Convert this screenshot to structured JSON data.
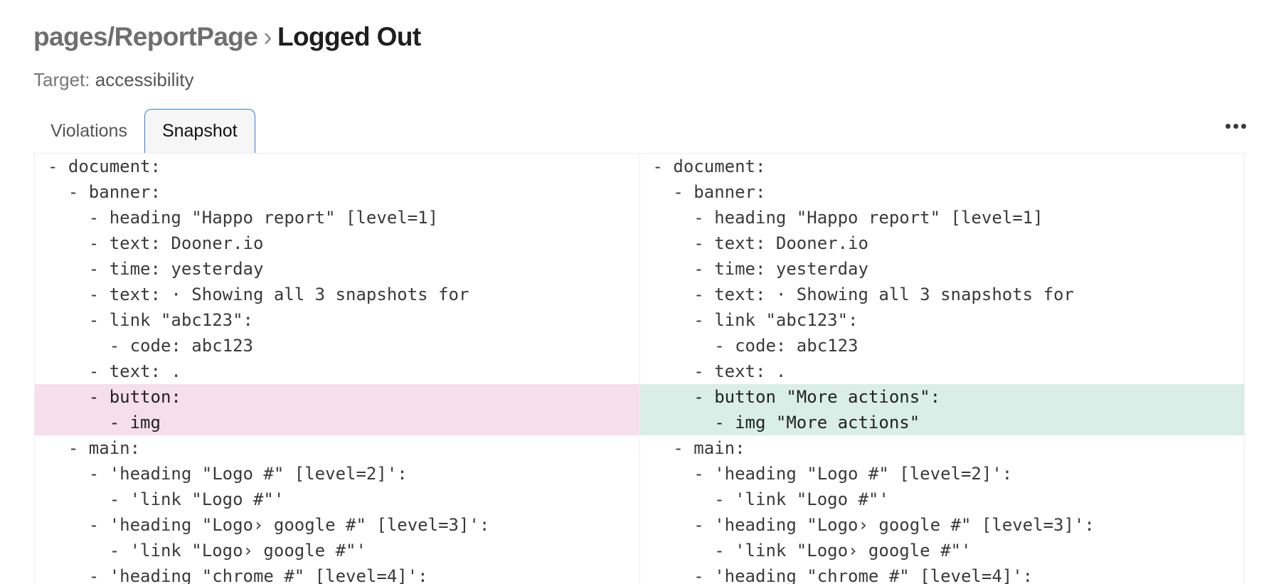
{
  "header": {
    "breadcrumb": "pages/ReportPage",
    "separator": "›",
    "title": "Logged Out",
    "target_label": "Target:",
    "target_value": "accessibility"
  },
  "tabs": [
    {
      "label": "Violations",
      "active": false
    },
    {
      "label": "Snapshot",
      "active": true
    }
  ],
  "menu_icon": "more-horizontal-icon",
  "colors": {
    "removed_bg": "#f6deec",
    "added_bg": "#d9eee7",
    "active_tab_border": "#2b7fe3"
  },
  "diff": {
    "left": [
      {
        "text": "- document:",
        "type": "same"
      },
      {
        "text": "  - banner:",
        "type": "same"
      },
      {
        "text": "    - heading \"Happo report\" [level=1]",
        "type": "same"
      },
      {
        "text": "    - text: Dooner.io",
        "type": "same"
      },
      {
        "text": "    - time: yesterday",
        "type": "same"
      },
      {
        "text": "    - text: · Showing all 3 snapshots for",
        "type": "same"
      },
      {
        "text": "    - link \"abc123\":",
        "type": "same"
      },
      {
        "text": "      - code: abc123",
        "type": "same"
      },
      {
        "text": "    - text: .",
        "type": "same"
      },
      {
        "text": "    - button:",
        "type": "removed"
      },
      {
        "text": "      - img",
        "type": "removed"
      },
      {
        "text": "  - main:",
        "type": "same"
      },
      {
        "text": "    - 'heading \"Logo #\" [level=2]':",
        "type": "same"
      },
      {
        "text": "      - 'link \"Logo #\"'",
        "type": "same"
      },
      {
        "text": "    - 'heading \"Logo› google #\" [level=3]':",
        "type": "same"
      },
      {
        "text": "      - 'link \"Logo› google #\"'",
        "type": "same"
      },
      {
        "text": "    - 'heading \"chrome #\" [level=4]':",
        "type": "same"
      }
    ],
    "right": [
      {
        "text": "- document:",
        "type": "same"
      },
      {
        "text": "  - banner:",
        "type": "same"
      },
      {
        "text": "    - heading \"Happo report\" [level=1]",
        "type": "same"
      },
      {
        "text": "    - text: Dooner.io",
        "type": "same"
      },
      {
        "text": "    - time: yesterday",
        "type": "same"
      },
      {
        "text": "    - text: · Showing all 3 snapshots for",
        "type": "same"
      },
      {
        "text": "    - link \"abc123\":",
        "type": "same"
      },
      {
        "text": "      - code: abc123",
        "type": "same"
      },
      {
        "text": "    - text: .",
        "type": "same"
      },
      {
        "text": "    - button \"More actions\":",
        "type": "added"
      },
      {
        "text": "      - img \"More actions\"",
        "type": "added"
      },
      {
        "text": "  - main:",
        "type": "same"
      },
      {
        "text": "    - 'heading \"Logo #\" [level=2]':",
        "type": "same"
      },
      {
        "text": "      - 'link \"Logo #\"'",
        "type": "same"
      },
      {
        "text": "    - 'heading \"Logo› google #\" [level=3]':",
        "type": "same"
      },
      {
        "text": "      - 'link \"Logo› google #\"'",
        "type": "same"
      },
      {
        "text": "    - 'heading \"chrome #\" [level=4]':",
        "type": "same"
      }
    ]
  }
}
